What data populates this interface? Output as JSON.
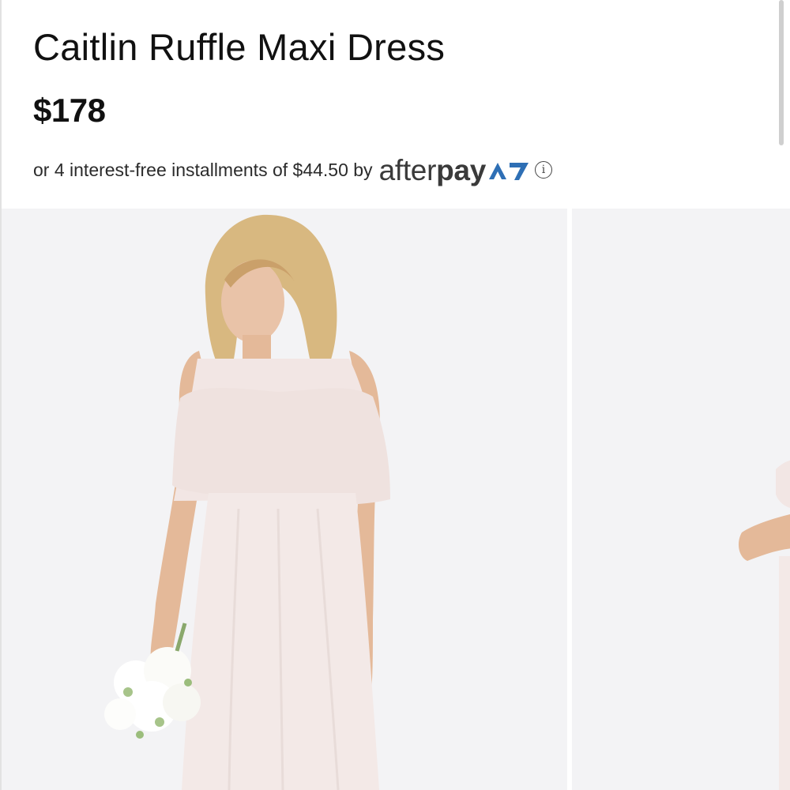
{
  "product": {
    "title": "Caitlin Ruffle Maxi Dress",
    "price": "$178"
  },
  "afterpay": {
    "text": "or 4 interest-free installments of $44.50 by",
    "logo_after": "after",
    "logo_pay": "pay",
    "info_icon": "info-circle-icon",
    "logo_mark_color": "#2e6fb5"
  },
  "gallery": {
    "background": "#f3f3f5",
    "dress_color": "#f2e6e4"
  }
}
